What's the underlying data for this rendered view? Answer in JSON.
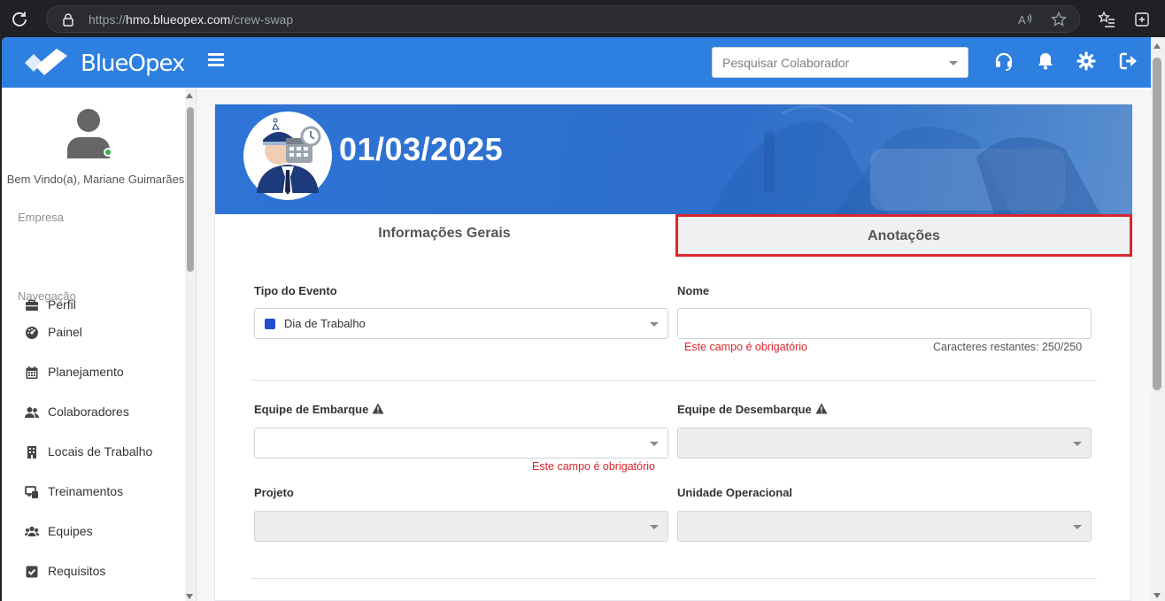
{
  "browser": {
    "url_prefix": "https://",
    "url_host": "hmo.blueopex.com",
    "url_path": "/crew-swap"
  },
  "header": {
    "brand": "BlueOpex",
    "search_placeholder": "Pesquisar Colaborador"
  },
  "sidebar": {
    "welcome": "Bem Vindo(a), Mariane Guimarães",
    "section_company": "Empresa",
    "section_nav": "Navegação",
    "company_items": [
      {
        "label": "Perfil",
        "icon": "briefcase-icon"
      }
    ],
    "nav_items": [
      {
        "label": "Painel",
        "icon": "dashboard-icon"
      },
      {
        "label": "Planejamento",
        "icon": "calendar-icon"
      },
      {
        "label": "Colaboradores",
        "icon": "users-icon"
      },
      {
        "label": "Locais de Trabalho",
        "icon": "building-icon"
      },
      {
        "label": "Treinamentos",
        "icon": "training-icon"
      },
      {
        "label": "Equipes",
        "icon": "team-icon"
      },
      {
        "label": "Requisitos",
        "icon": "checkbox-icon"
      }
    ]
  },
  "event": {
    "date": "01/03/2025",
    "tabs": [
      "Informações Gerais",
      "Anotações"
    ],
    "active_tab_highlight": "#d9262c"
  },
  "form": {
    "event_type_label": "Tipo do Evento",
    "event_type_value": "Dia de Trabalho",
    "event_type_color": "#1f4fcf",
    "name_label": "Nome",
    "name_value": "",
    "name_error": "Este campo é obrigatório",
    "name_counter": "Caracteres restantes: 250/250",
    "boarding_team_label": "Equipe de Embarque",
    "boarding_team_error": "Este campo é obrigatório",
    "disembark_team_label": "Equipe de Desembarque",
    "project_label": "Projeto",
    "unit_label": "Unidade Operacional"
  },
  "colors": {
    "brand_blue": "#2d7fe0",
    "error_red": "#d9262c"
  }
}
